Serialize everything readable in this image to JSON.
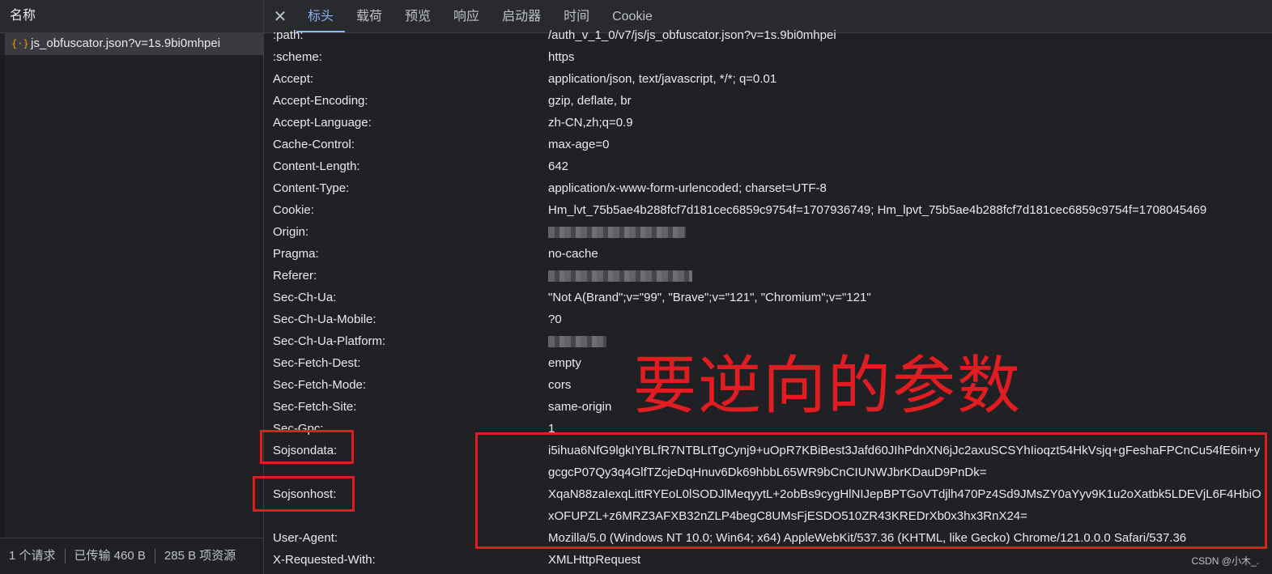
{
  "left": {
    "header": "名称",
    "request_icon": "{·}",
    "request_name": "js_obfuscator.json?v=1s.9bi0mhpei",
    "footer": [
      "1 个请求",
      "已传输 460 B",
      "285 B 项资源"
    ]
  },
  "tabs": [
    "标头",
    "载荷",
    "预览",
    "响应",
    "启动器",
    "时间",
    "Cookie"
  ],
  "close_icon": "✕",
  "headers": [
    {
      "k": ":path:",
      "v": "/auth_v_1_0/v7/js/js_obfuscator.json?v=1s.9bi0mhpei"
    },
    {
      "k": ":scheme:",
      "v": "https"
    },
    {
      "k": "Accept:",
      "v": "application/json, text/javascript, */*; q=0.01"
    },
    {
      "k": "Accept-Encoding:",
      "v": "gzip, deflate, br"
    },
    {
      "k": "Accept-Language:",
      "v": "zh-CN,zh;q=0.9"
    },
    {
      "k": "Cache-Control:",
      "v": "max-age=0"
    },
    {
      "k": "Content-Length:",
      "v": "642"
    },
    {
      "k": "Content-Type:",
      "v": "application/x-www-form-urlencoded; charset=UTF-8"
    },
    {
      "k": "Cookie:",
      "v": "Hm_lvt_75b5ae4b288fcf7d181cec6859c9754f=1707936749; Hm_lpvt_75b5ae4b288fcf7d181cec6859c9754f=1708045469"
    },
    {
      "k": "Origin:",
      "v": ""
    },
    {
      "k": "Pragma:",
      "v": "no-cache"
    },
    {
      "k": "Referer:",
      "v": ""
    },
    {
      "k": "Sec-Ch-Ua:",
      "v": "\"Not A(Brand\";v=\"99\", \"Brave\";v=\"121\", \"Chromium\";v=\"121\""
    },
    {
      "k": "Sec-Ch-Ua-Mobile:",
      "v": "?0"
    },
    {
      "k": "Sec-Ch-Ua-Platform:",
      "v": ""
    },
    {
      "k": "Sec-Fetch-Dest:",
      "v": "empty"
    },
    {
      "k": "Sec-Fetch-Mode:",
      "v": "cors"
    },
    {
      "k": "Sec-Fetch-Site:",
      "v": "same-origin"
    },
    {
      "k": "Sec-Gpc:",
      "v": "1"
    },
    {
      "k": "Sojsondata:",
      "v": "i5ihua6NfG9lgkIYBLfR7NTBLtTgCynj9+uOpR7KBiBest3Jafd60JIhPdnXN6jJc2axuSCSYhIioqzt54HkVsjq+gFeshaFPCnCu54fE6in+ygcgcP07Qy3q4GlfTZcjeDqHnuv6Dk69hbbL65WR9bCnCIUNWJbrKDauD9PnDk="
    },
    {
      "k": "Sojsonhost:",
      "v": "XqaN88zaIexqLittRYEoL0lSODJlMeqyytL+2obBs9cygHlNIJepBPTGoVTdjlh470Pz4Sd9JMsZY0aYyv9K1u2oXatbk5LDEVjL6F4HbiOxOFUPZL+z6MRZ3AFXB32nZLP4begC8UMsFjESDO510ZR43KREDrXb0x3hx3RnX24="
    },
    {
      "k": "User-Agent:",
      "v": "Mozilla/5.0 (Windows NT 10.0; Win64; x64) AppleWebKit/537.36 (KHTML, like Gecko) Chrome/121.0.0.0 Safari/537.36"
    },
    {
      "k": "X-Requested-With:",
      "v": "XMLHttpRequest"
    }
  ],
  "annotation_text": "要逆向的参数",
  "watermark": "CSDN @小木_.",
  "colors": {
    "bg": "#202124",
    "accent": "#8ab4f8",
    "annotation": "#e11d22"
  }
}
